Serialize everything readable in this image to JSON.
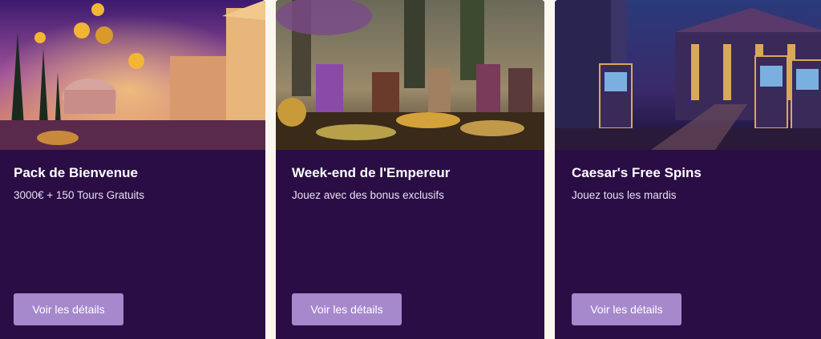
{
  "promotions": [
    {
      "title": "Pack de Bienvenue",
      "subtitle": "3000€ + 150 Tours Gratuits",
      "button_label": "Voir les détails"
    },
    {
      "title": "Week-end de l'Empereur",
      "subtitle": "Jouez avec des bonus exclusifs",
      "button_label": "Voir les détails"
    },
    {
      "title": "Caesar's Free Spins",
      "subtitle": "Jouez tous les mardis",
      "button_label": "Voir les détails"
    }
  ],
  "colors": {
    "page_bg": "#fbf7ee",
    "card_bg": "#2a0d45",
    "button_bg": "#a688cc",
    "title_text": "#ffffff"
  }
}
